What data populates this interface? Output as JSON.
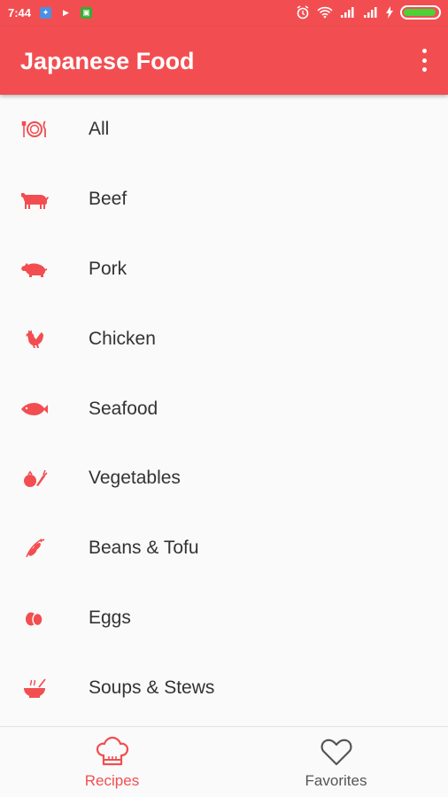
{
  "status_bar": {
    "time": "7:44"
  },
  "app_bar": {
    "title": "Japanese Food"
  },
  "categories": [
    {
      "label": "All",
      "icon": "plate-cutlery-icon"
    },
    {
      "label": "Beef",
      "icon": "cow-icon"
    },
    {
      "label": "Pork",
      "icon": "pig-icon"
    },
    {
      "label": "Chicken",
      "icon": "chicken-icon"
    },
    {
      "label": "Seafood",
      "icon": "fish-icon"
    },
    {
      "label": "Vegetables",
      "icon": "vegetables-icon"
    },
    {
      "label": "Beans & Tofu",
      "icon": "beans-icon"
    },
    {
      "label": "Eggs",
      "icon": "eggs-icon"
    },
    {
      "label": "Soups & Stews",
      "icon": "soup-bowl-icon"
    }
  ],
  "bottom_nav": [
    {
      "label": "Recipes",
      "icon": "chef-hat-icon",
      "active": true
    },
    {
      "label": "Favorites",
      "icon": "heart-icon",
      "active": false
    }
  ],
  "colors": {
    "accent": "#f24e51",
    "text": "#333333",
    "inactive": "#555555"
  }
}
